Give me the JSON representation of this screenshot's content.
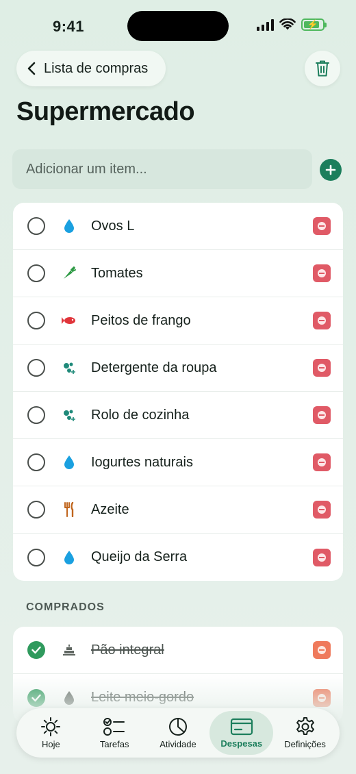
{
  "status": {
    "time": "9:41"
  },
  "header": {
    "back_label": "Lista de compras",
    "title": "Supermercado"
  },
  "add_item": {
    "placeholder": "Adicionar um item..."
  },
  "pending_items": [
    {
      "label": "Ovos L",
      "icon": "drop-icon",
      "color": "#1aa0e0"
    },
    {
      "label": "Tomates",
      "icon": "carrot-icon",
      "color": "#2e9a45"
    },
    {
      "label": "Peitos de frango",
      "icon": "fish-icon",
      "color": "#e0343a"
    },
    {
      "label": "Detergente da roupa",
      "icon": "bubbles-icon",
      "color": "#1f8a7a"
    },
    {
      "label": "Rolo de cozinha",
      "icon": "bubbles-icon",
      "color": "#1f8a7a"
    },
    {
      "label": "Iogurtes naturais",
      "icon": "drop-icon",
      "color": "#1aa0e0"
    },
    {
      "label": "Azeite",
      "icon": "fork-knife-icon",
      "color": "#c0651c"
    },
    {
      "label": "Queijo da Serra",
      "icon": "drop-icon",
      "color": "#1aa0e0"
    }
  ],
  "completed_section": {
    "label": "COMPRADOS"
  },
  "completed_items": [
    {
      "label": "Pão integral",
      "icon": "cake-icon"
    },
    {
      "label": "Leite meio-gordo",
      "icon": "drop-icon"
    }
  ],
  "tabs": [
    {
      "label": "Hoje",
      "icon": "sun-icon"
    },
    {
      "label": "Tarefas",
      "icon": "checklist-icon"
    },
    {
      "label": "Atividade",
      "icon": "pie-chart-icon"
    },
    {
      "label": "Despesas",
      "icon": "card-icon",
      "active": true
    },
    {
      "label": "Definições",
      "icon": "gear-icon"
    }
  ],
  "colors": {
    "accent": "#1c7e5c",
    "done": "#2f9a5d",
    "badge": "#e05a66"
  }
}
